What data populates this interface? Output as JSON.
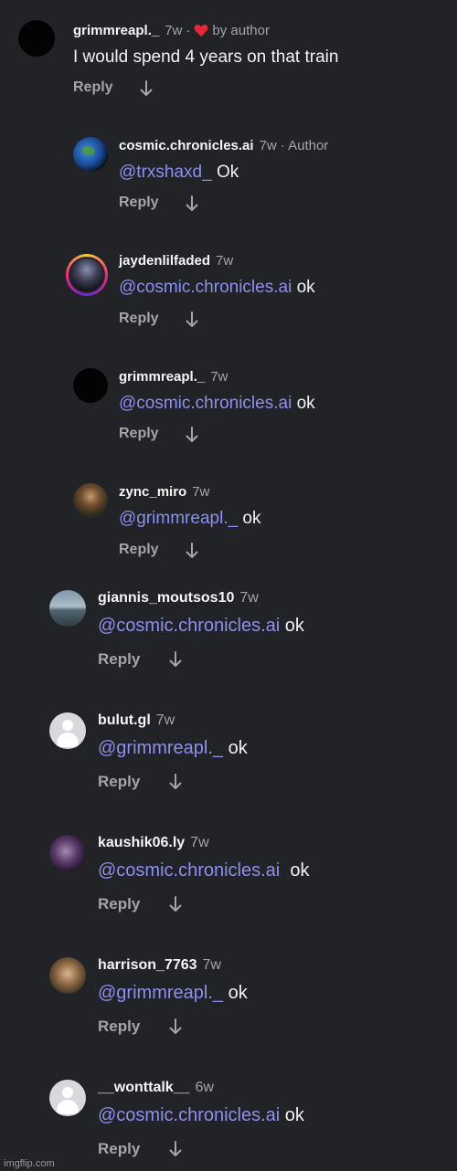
{
  "reply_label": "Reply",
  "colors": {
    "background": "#222326",
    "mention": "#8d8ff0",
    "muted": "#a4a5aa",
    "heart": "#e8253a"
  },
  "top_comment": {
    "username": "grimmreapl._",
    "time": "7w",
    "dot": "·",
    "liked_by": "by author",
    "text": "I would spend 4 years on that train",
    "avatar": "black-avatar"
  },
  "replies": [
    {
      "username": "cosmic.chronicles.ai",
      "time": "7w",
      "badge": "· Author",
      "mention": "@trxshaxd_",
      "text": " Ok",
      "avatar": "earth-avatar"
    },
    {
      "username": "jaydenlilfaded",
      "time": "7w",
      "mention": "@cosmic.chronicles.ai",
      "text": " ok",
      "avatar": "story-ring-avatar"
    },
    {
      "username": "grimmreapl._",
      "time": "7w",
      "mention": "@cosmic.chronicles.ai",
      "text": " ok",
      "avatar": "black-avatar"
    },
    {
      "username": "zync_miro",
      "time": "7w",
      "mention": "@grimmreapl._",
      "text": " ok",
      "avatar": "photo-avatar"
    },
    {
      "username": "giannis_moutsos10",
      "time": "7w",
      "mention": "@cosmic.chronicles.ai",
      "text": " ok",
      "avatar": "sea-avatar"
    },
    {
      "username": "bulut.gl",
      "time": "7w",
      "mention": "@grimmreapl._",
      "text": " ok",
      "avatar": "default-avatar"
    },
    {
      "username": "kaushik06.ly",
      "time": "7w",
      "mention": "@cosmic.chronicles.ai",
      "text": "  ok",
      "avatar": "photo-avatar"
    },
    {
      "username": "harrison_7763",
      "time": "7w",
      "mention": "@grimmreapl._",
      "text": " ok",
      "avatar": "dog-avatar"
    },
    {
      "username": "__wonttalk__",
      "time": "6w",
      "mention": "@cosmic.chronicles.ai",
      "text": " ok",
      "avatar": "default-avatar"
    }
  ],
  "footer": "imgflip.com"
}
